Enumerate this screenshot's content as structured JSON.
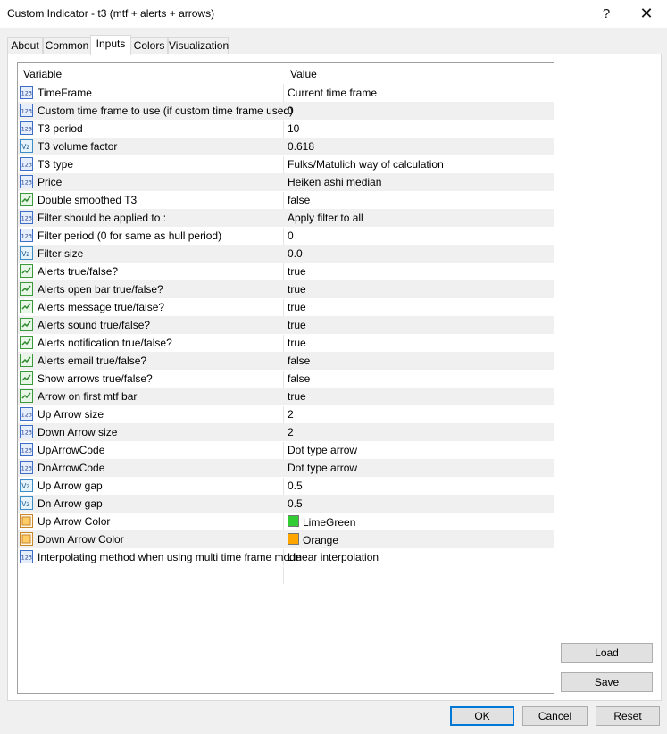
{
  "window": {
    "title": "Custom Indicator - t3 (mtf + alerts + arrows)",
    "help_label": "?",
    "close_label": "✕"
  },
  "tabs": [
    {
      "label": "About"
    },
    {
      "label": "Common"
    },
    {
      "label": "Inputs"
    },
    {
      "label": "Colors"
    },
    {
      "label": "Visualization"
    }
  ],
  "active_tab": "Inputs",
  "grid": {
    "headers": {
      "variable": "Variable",
      "value": "Value"
    },
    "rows": [
      {
        "name": "TimeFrame",
        "value": "Current time frame",
        "icon": "int-icon"
      },
      {
        "name": "Custom time frame to use (if custom time frame used)",
        "value": "0",
        "icon": "int-icon"
      },
      {
        "name": "T3 period",
        "value": "10",
        "icon": "int-icon"
      },
      {
        "name": "T3 volume factor",
        "value": "0.618",
        "icon": "double-icon"
      },
      {
        "name": "T3 type",
        "value": "Fulks/Matulich way of calculation",
        "icon": "int-icon"
      },
      {
        "name": "Price",
        "value": "Heiken ashi median",
        "icon": "int-icon"
      },
      {
        "name": "Double smoothed T3",
        "value": "false",
        "icon": "bool-icon"
      },
      {
        "name": "Filter should be applied to :",
        "value": "Apply filter to all",
        "icon": "int-icon"
      },
      {
        "name": "Filter period (0 for same as hull period)",
        "value": "0",
        "icon": "int-icon"
      },
      {
        "name": "Filter size",
        "value": "0.0",
        "icon": "double-icon"
      },
      {
        "name": "Alerts true/false?",
        "value": "true",
        "icon": "bool-icon"
      },
      {
        "name": "Alerts open bar true/false?",
        "value": "true",
        "icon": "bool-icon"
      },
      {
        "name": "Alerts message true/false?",
        "value": "true",
        "icon": "bool-icon"
      },
      {
        "name": "Alerts sound true/false?",
        "value": "true",
        "icon": "bool-icon"
      },
      {
        "name": "Alerts notification true/false?",
        "value": "true",
        "icon": "bool-icon"
      },
      {
        "name": "Alerts email true/false?",
        "value": "false",
        "icon": "bool-icon"
      },
      {
        "name": "Show arrows true/false?",
        "value": "false",
        "icon": "bool-icon"
      },
      {
        "name": "Arrow on first mtf bar",
        "value": "true",
        "icon": "bool-icon"
      },
      {
        "name": "Up Arrow size",
        "value": "2",
        "icon": "int-icon"
      },
      {
        "name": "Down Arrow size",
        "value": "2",
        "icon": "int-icon"
      },
      {
        "name": "UpArrowCode",
        "value": "Dot type arrow",
        "icon": "int-icon"
      },
      {
        "name": "DnArrowCode",
        "value": "Dot type arrow",
        "icon": "int-icon"
      },
      {
        "name": "Up Arrow gap",
        "value": "0.5",
        "icon": "double-icon"
      },
      {
        "name": "Dn Arrow gap",
        "value": "0.5",
        "icon": "double-icon"
      },
      {
        "name": "Up Arrow Color",
        "value": "LimeGreen",
        "icon": "color-icon",
        "swatch": "#32cd32"
      },
      {
        "name": "Down Arrow Color",
        "value": "Orange",
        "icon": "color-icon",
        "swatch": "#ffa500"
      },
      {
        "name": "Interpolating method when using multi time frame mode",
        "value": "Linear interpolation",
        "icon": "int-icon"
      }
    ]
  },
  "side_buttons": {
    "load": "Load",
    "save": "Save"
  },
  "footer_buttons": {
    "ok": "OK",
    "cancel": "Cancel",
    "reset": "Reset"
  },
  "colors": {
    "accent": "#0078d7",
    "row_alt": "#f0f0f0"
  }
}
